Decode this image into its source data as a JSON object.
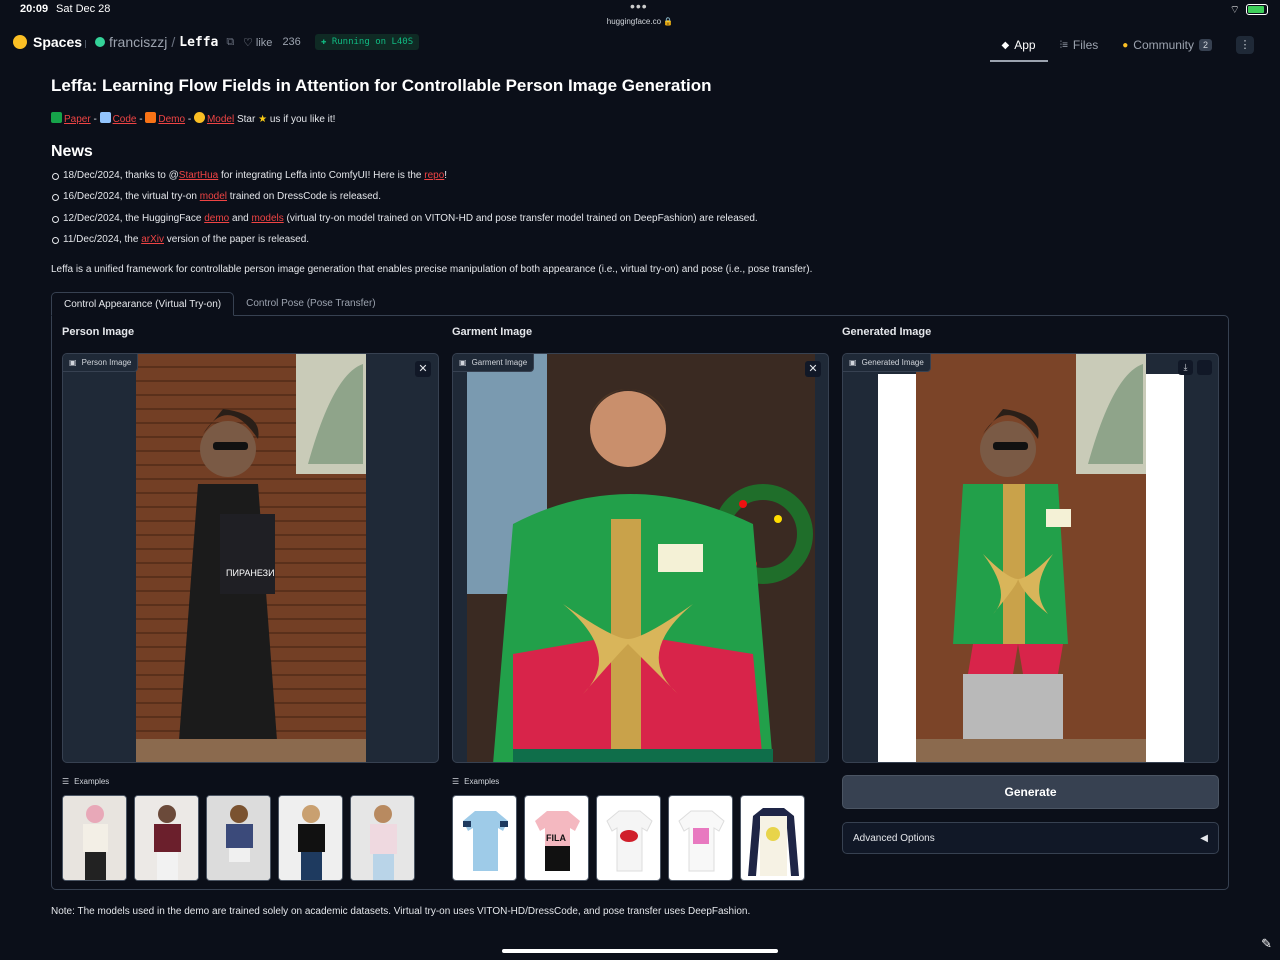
{
  "status": {
    "time": "20:09",
    "date": "Sat Dec 28",
    "url": "huggingface.co",
    "battery_level": 0.9
  },
  "nav": {
    "brand": "Spaces",
    "owner": "franciszzj",
    "repo": "Leffa",
    "like_label": "like",
    "like_count": "236",
    "running": "Running on L40S",
    "tabs": [
      {
        "label": "App",
        "icon": "cube-icon"
      },
      {
        "label": "Files",
        "icon": "files-icon"
      },
      {
        "label": "Community",
        "icon": "community-icon",
        "badge": "2"
      }
    ]
  },
  "page": {
    "title": "Leffa: Learning Flow Fields in Attention for Controllable Person Image Generation",
    "links": {
      "paper": "Paper",
      "code": "Code",
      "demo": "Demo",
      "model": "Model",
      "star_text": "Star",
      "tail": "us if you like it!"
    },
    "news_heading": "News",
    "news": [
      {
        "pre": "18/Dec/2024, thanks to @",
        "link1": "StartHua",
        "mid": " for integrating Leffa into ComfyUI! Here is the ",
        "link2": "repo",
        "post": "!"
      },
      {
        "pre": "16/Dec/2024, the virtual try-on ",
        "link1": "model",
        "mid": " trained on DressCode is released."
      },
      {
        "pre": "12/Dec/2024, the HuggingFace ",
        "link1": "demo",
        "mid": " and ",
        "link2": "models",
        "post": " (virtual try-on model trained on VITON-HD and pose transfer model trained on DeepFashion) are released."
      },
      {
        "pre": "11/Dec/2024, the ",
        "link1": "arXiv",
        "mid": " version of the paper is released."
      }
    ],
    "description": "Leffa is a unified framework for controllable person image generation that enables precise manipulation of both appearance (i.e., virtual try-on) and pose (i.e., pose transfer).",
    "tabs": [
      "Control Appearance (Virtual Try-on)",
      "Control Pose (Pose Transfer)"
    ],
    "columns": {
      "person": {
        "title": "Person Image",
        "label": "Person Image",
        "examples": "Examples"
      },
      "garment": {
        "title": "Garment Image",
        "label": "Garment Image",
        "examples": "Examples"
      },
      "generated": {
        "title": "Generated Image",
        "label": "Generated Image"
      }
    },
    "generate_button": "Generate",
    "advanced_options": "Advanced Options",
    "note": "Note: The models used in the demo are trained solely on academic datasets. Virtual try-on uses VITON-HD/DressCode, and pose transfer uses DeepFashion."
  },
  "colors": {
    "accent_link": "#ef4444",
    "running": "#10b981",
    "background": "#0b0f19"
  }
}
